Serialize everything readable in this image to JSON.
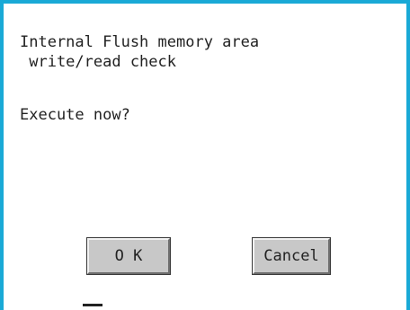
{
  "dialog": {
    "message_line_1": "Internal Flush memory area",
    "message_line_2": " write/read check",
    "prompt": "Execute now?"
  },
  "buttons": {
    "ok_label": "O K",
    "cancel_label": "Cancel"
  },
  "colors": {
    "frame": "#19a9d6",
    "button_face": "#c8c8c8",
    "background": "#ffffff",
    "text": "#222222"
  }
}
